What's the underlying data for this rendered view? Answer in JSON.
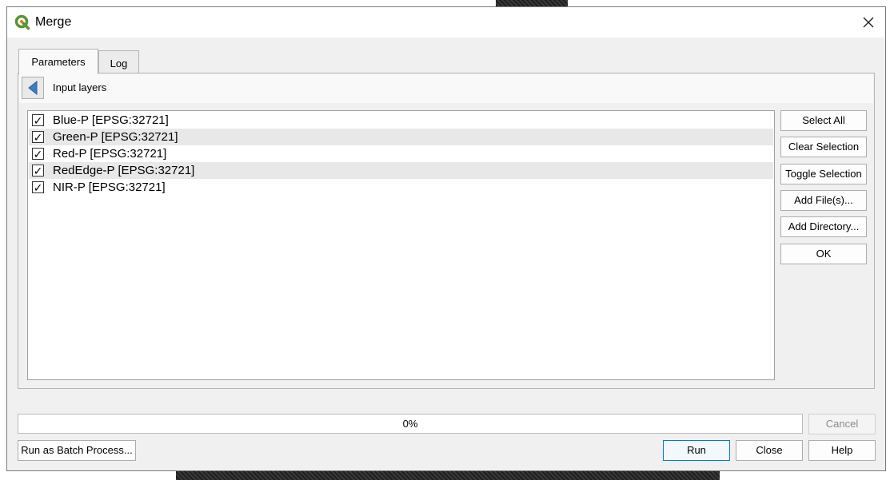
{
  "window": {
    "title": "Merge",
    "close_glyph": "✕"
  },
  "tabs": [
    {
      "label": "Parameters",
      "active": true
    },
    {
      "label": "Log",
      "active": false
    }
  ],
  "panel": {
    "title": "Input layers"
  },
  "layers": [
    {
      "label": "Blue-P [EPSG:32721]",
      "checked": true
    },
    {
      "label": "Green-P [EPSG:32721]",
      "checked": true
    },
    {
      "label": "Red-P [EPSG:32721]",
      "checked": true
    },
    {
      "label": "RedEdge-P [EPSG:32721]",
      "checked": true
    },
    {
      "label": "NIR-P [EPSG:32721]",
      "checked": true
    }
  ],
  "side_buttons": {
    "select_all": "Select All",
    "clear_selection": "Clear Selection",
    "toggle_selection": "Toggle Selection",
    "add_files": "Add File(s)...",
    "add_directory": "Add Directory...",
    "ok": "OK"
  },
  "progress": {
    "text": "0%",
    "value": 0
  },
  "bottom_buttons": {
    "cancel": "Cancel",
    "batch": "Run as Batch Process...",
    "run": "Run",
    "close": "Close",
    "help": "Help"
  },
  "colors": {
    "qgis_green": "#589632",
    "qgis_yellow": "#ee7913",
    "back_arrow": "#3a7fc2",
    "default_button_border": "#0078d7"
  },
  "icons": {
    "app": "qgis-logo-icon",
    "back": "back-arrow-icon",
    "close": "close-icon",
    "check": "checkmark-icon"
  }
}
